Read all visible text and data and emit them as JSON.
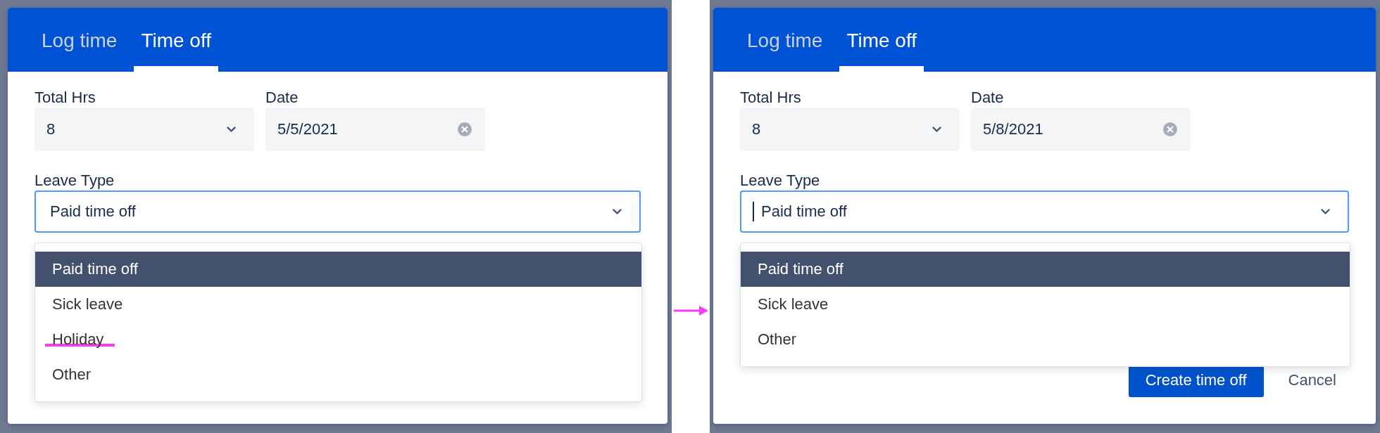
{
  "panels": [
    {
      "tabs": [
        {
          "label": "Log time",
          "selected": false
        },
        {
          "label": "Time off",
          "selected": true
        }
      ],
      "fields": [
        {
          "kind": "select",
          "label": "Total Hrs",
          "value": "8"
        },
        {
          "kind": "date",
          "label": "Date",
          "value": "5/5/2021"
        }
      ],
      "leave_type": {
        "label": "Leave Type",
        "value": "Paid time off",
        "focused": true,
        "cursor": false
      },
      "menu": {
        "options": [
          {
            "label": "Paid time off",
            "selected": true,
            "struck": false
          },
          {
            "label": "Sick leave",
            "selected": false,
            "struck": false
          },
          {
            "label": "Holiday",
            "selected": false,
            "struck": true
          },
          {
            "label": "Other",
            "selected": false,
            "struck": false
          }
        ]
      }
    },
    {
      "tabs": [
        {
          "label": "Log time",
          "selected": false
        },
        {
          "label": "Time off",
          "selected": true
        }
      ],
      "fields": [
        {
          "kind": "select",
          "label": "Total Hrs",
          "value": "8"
        },
        {
          "kind": "date",
          "label": "Date",
          "value": "5/8/2021"
        }
      ],
      "leave_type": {
        "label": "Leave Type",
        "value": "Paid time off",
        "focused": true,
        "cursor": true
      },
      "menu": {
        "options": [
          {
            "label": "Paid time off",
            "selected": true,
            "struck": false
          },
          {
            "label": "Sick leave",
            "selected": false,
            "struck": false
          },
          {
            "label": "Other",
            "selected": false,
            "struck": false
          }
        ]
      },
      "buttons": [
        {
          "kind": "primary",
          "label": "Create time off"
        },
        {
          "kind": "subtle",
          "label": "Cancel"
        }
      ]
    }
  ]
}
